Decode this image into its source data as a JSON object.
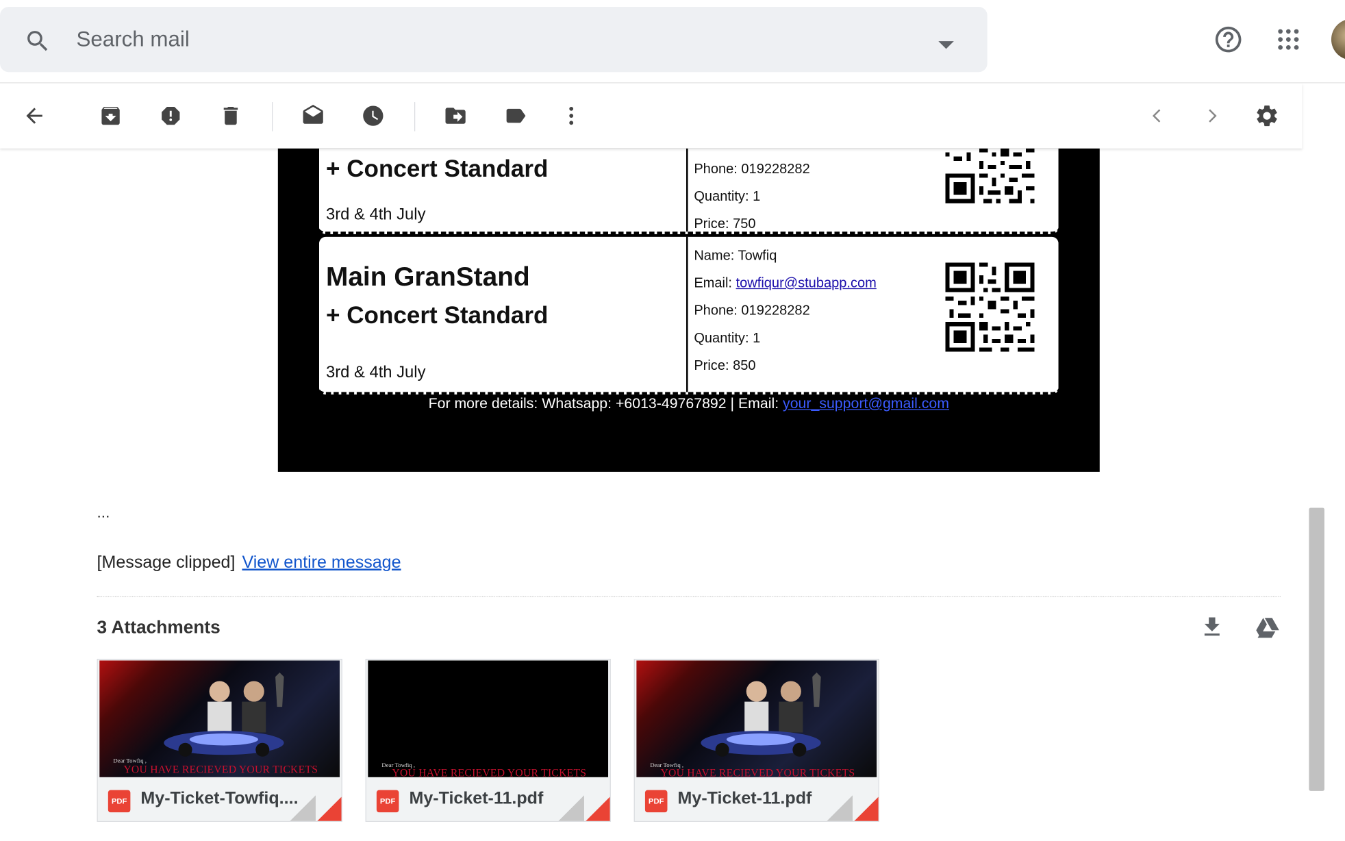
{
  "search": {
    "placeholder": "Search mail",
    "icon": "search-icon",
    "dropdown_icon": "caret-down-icon"
  },
  "header": {
    "help_icon": "help-icon",
    "apps_icon": "apps-grid-icon",
    "avatar_icon": "avatar"
  },
  "toolbar": {
    "items": [
      "back-arrow-icon",
      "archive-icon",
      "report-spam-icon",
      "delete-icon",
      "mark-unread-icon",
      "snooze-icon",
      "move-to-icon",
      "label-icon",
      "more-options-icon"
    ],
    "right": [
      "chevron-left-icon",
      "chevron-right-icon",
      "settings-icon"
    ]
  },
  "tickets": [
    {
      "title": "",
      "subtitle": "+ Concert Standard",
      "date": "3rd & 4th July",
      "phone": "Phone: 019228282",
      "quantity": "Quantity: 1",
      "price": "Price: 750"
    },
    {
      "title": "Main GranStand",
      "subtitle": "+ Concert Standard",
      "date": "3rd & 4th July",
      "name": "Name: Towfiq",
      "email_label": "Email: ",
      "email": "towfiqur@stubapp.com",
      "phone": "Phone: 019228282",
      "quantity": "Quantity: 1",
      "price": "Price: 850"
    }
  ],
  "ticket_footer": {
    "text": "For more details: Whatsapp: +6013-49767892 | Email: ",
    "email": "your_support@gmail.com"
  },
  "message": {
    "ellipsis": "...",
    "clipped_label": "[Message clipped]",
    "view_entire": "View entire message"
  },
  "attachments": {
    "title": "3 Attachments",
    "download_all_icon": "download-icon",
    "drive_icon": "drive-icon",
    "items": [
      {
        "name": "My-Ticket-Towfiq....",
        "badge": "PDF",
        "dear": "Dear Towfiq ,",
        "headline": "YOU HAVE RECIEVED YOUR TICKETS",
        "thumb": "art"
      },
      {
        "name": "My-Ticket-11.pdf",
        "badge": "PDF",
        "dear": "Dear Towfiq ,",
        "headline": "YOU HAVE RECIEVED YOUR TICKETS",
        "thumb": "black"
      },
      {
        "name": "My-Ticket-11.pdf",
        "badge": "PDF",
        "dear": "Dear Towfiq ,",
        "headline": "YOU HAVE RECIEVED YOUR TICKETS",
        "thumb": "art"
      }
    ]
  },
  "colors": {
    "link": "#1155cc",
    "pdf_red": "#ea4335",
    "headline_red": "#c8102e"
  }
}
